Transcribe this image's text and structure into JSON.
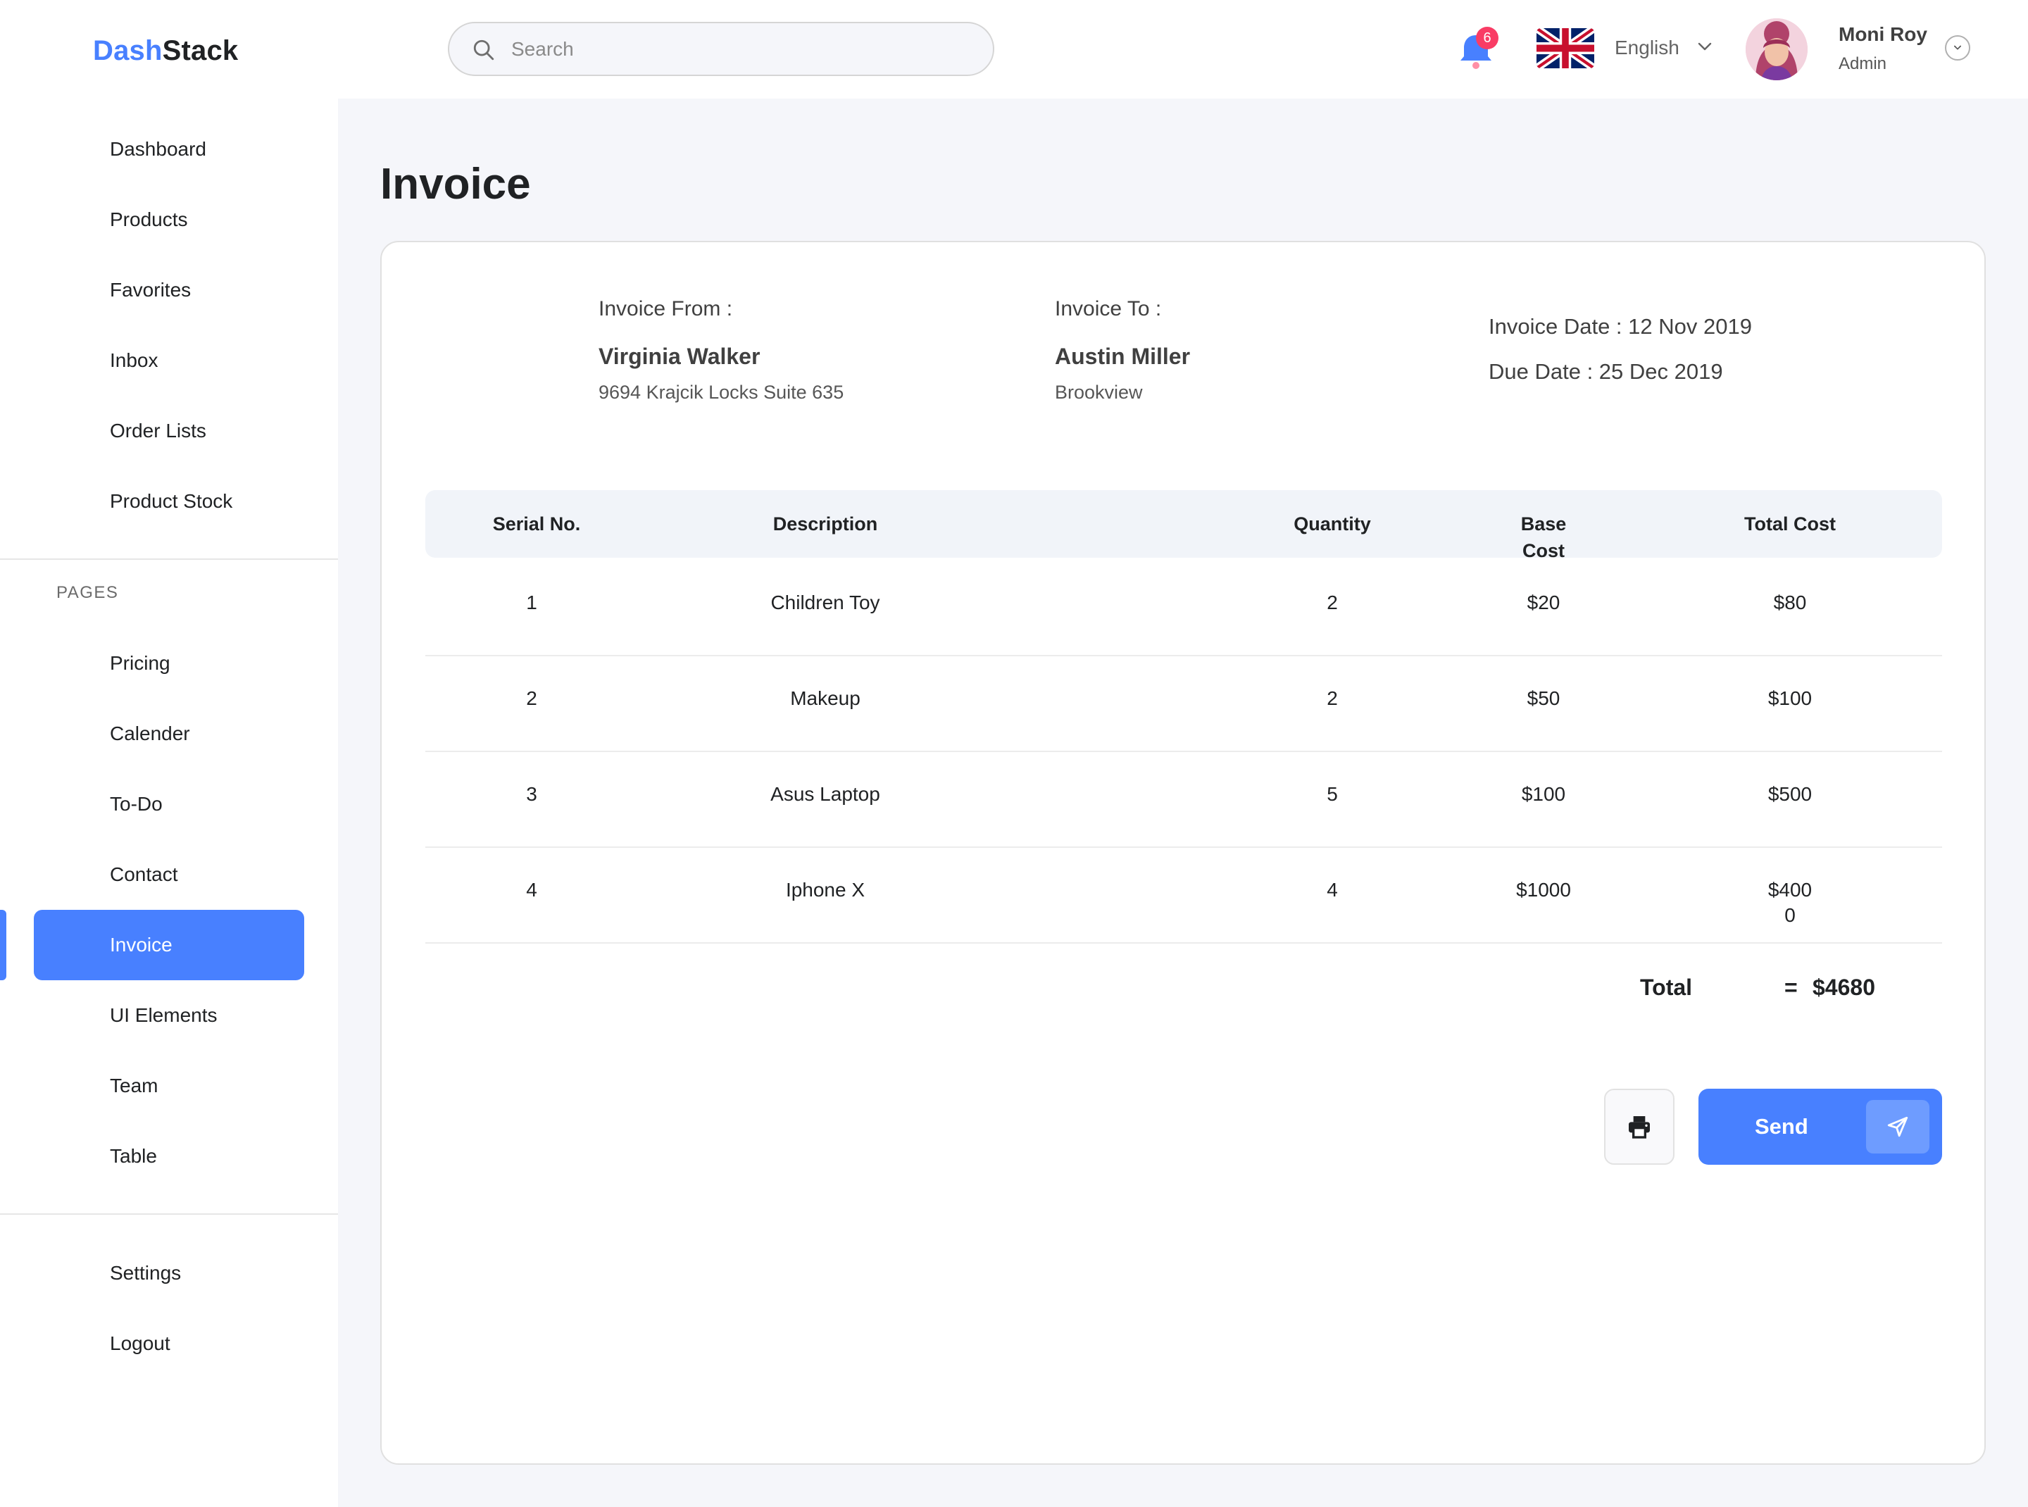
{
  "brand": {
    "part1": "Dash",
    "part2": "Stack"
  },
  "sidebar": {
    "main_items": [
      {
        "label": "Dashboard"
      },
      {
        "label": "Products"
      },
      {
        "label": "Favorites"
      },
      {
        "label": "Inbox"
      },
      {
        "label": "Order Lists"
      },
      {
        "label": "Product Stock"
      }
    ],
    "pages_title": "PAGES",
    "page_items": [
      {
        "label": "Pricing"
      },
      {
        "label": "Calender"
      },
      {
        "label": "To-Do"
      },
      {
        "label": "Contact"
      },
      {
        "label": "Invoice",
        "active": true
      },
      {
        "label": "UI Elements"
      },
      {
        "label": "Team"
      },
      {
        "label": "Table"
      }
    ],
    "bottom_items": [
      {
        "label": "Settings"
      },
      {
        "label": "Logout"
      }
    ]
  },
  "topbar": {
    "search": {
      "placeholder": "Search",
      "value": ""
    },
    "notifications": {
      "count": "6",
      "icon": "bell-icon"
    },
    "language": {
      "label": "English",
      "flag": "uk-flag-icon"
    },
    "user": {
      "name": "Moni Roy",
      "role": "Admin"
    }
  },
  "page": {
    "title": "Invoice"
  },
  "invoice": {
    "from": {
      "label": "Invoice From :",
      "name": "Virginia Walker",
      "address": "9694 Krajcik Locks Suite 635"
    },
    "to": {
      "label": "Invoice To :",
      "name": "Austin Miller",
      "address": "Brookview"
    },
    "invoice_date": "Invoice Date : 12 Nov 2019",
    "due_date": "Due Date : 25 Dec 2019",
    "columns": {
      "serial": "Serial No.",
      "description": "Description",
      "quantity": "Quantity",
      "base_cost_line1": "Base",
      "base_cost_line2": "Cost",
      "total_cost": "Total Cost"
    },
    "rows": [
      {
        "serial": "1",
        "description": "Children Toy",
        "quantity": "2",
        "base_cost": "$20",
        "total_cost": "$80"
      },
      {
        "serial": "2",
        "description": "Makeup",
        "quantity": "2",
        "base_cost": "$50",
        "total_cost": "$100"
      },
      {
        "serial": "3",
        "description": "Asus Laptop",
        "quantity": "5",
        "base_cost": "$100",
        "total_cost": "$500"
      },
      {
        "serial": "4",
        "description": "Iphone X",
        "quantity": "4",
        "base_cost": "$1000",
        "total_cost_line1": "$400",
        "total_cost_line2": "0"
      }
    ],
    "total": {
      "label": "Total",
      "equals": "=",
      "value": "$4680"
    }
  },
  "actions": {
    "send_label": "Send"
  },
  "colors": {
    "accent": "#4880ff",
    "badge": "#f93c65",
    "page_bg": "#f5f6fa"
  }
}
